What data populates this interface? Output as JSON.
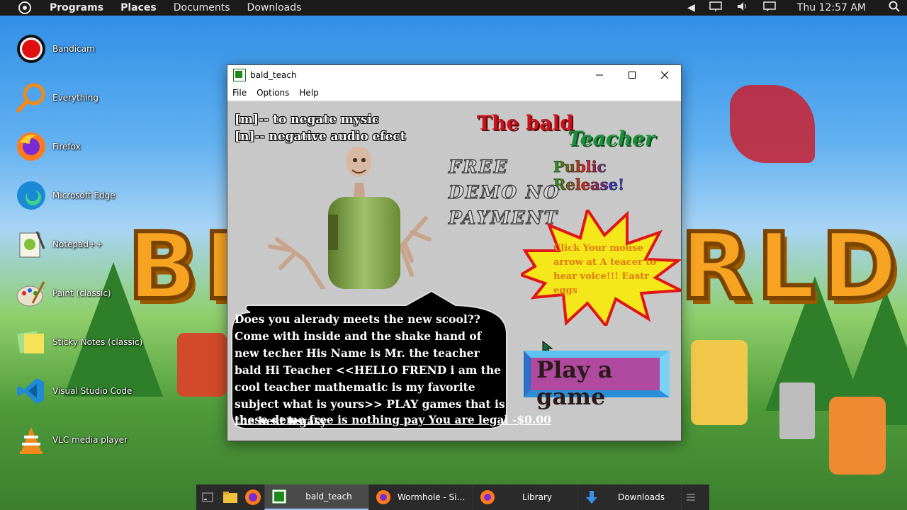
{
  "top_panel": {
    "menus": [
      "Programs",
      "Places",
      "Documents",
      "Downloads"
    ],
    "clock": "Thu 12:57 AM"
  },
  "desktop_icons": [
    {
      "label": "Bandicam",
      "icon": "bandicam-icon"
    },
    {
      "label": "Everything",
      "icon": "everything-search-icon"
    },
    {
      "label": "Firefox",
      "icon": "firefox-icon"
    },
    {
      "label": "Microsoft Edge",
      "icon": "edge-icon"
    },
    {
      "label": "Notepad++",
      "icon": "notepadpp-icon"
    },
    {
      "label": "Paint (classic)",
      "icon": "paint-icon"
    },
    {
      "label": "Sticky Notes (classic)",
      "icon": "sticky-notes-icon"
    },
    {
      "label": "Visual Studio Code",
      "icon": "vscode-icon"
    },
    {
      "label": "VLC media player",
      "icon": "vlc-icon"
    }
  ],
  "window": {
    "title": "bald_teach",
    "menu": [
      "File",
      "Options",
      "Help"
    ],
    "hint_lines": [
      "[m]-- to negate mysic",
      "[n]-- negative audio efect"
    ],
    "title_bald": "The bald",
    "title_teacher": "Teacher",
    "public_release": "Public Release!",
    "free_lines": [
      "FREE",
      "DEMO NO",
      "PAYMENT"
    ],
    "star_text": "Click Your mouse arrow at A teacer to hear voice!!! Eastr eggs",
    "bubble_text": "Does you alerady meets the new scool??Come with inside and the shake hand of new techer His Name is Mr. the teacher bald Hi Teacher <<HELLO FREND i am the cool teacher mathematic is my favorite subject what is yours>> PLAY games that is the best legasy",
    "bubble_footer": "these demo free is nothing pay You are legal -$0.00",
    "play_label": "Play a game"
  },
  "taskbar": {
    "tasks": [
      "bald_teach",
      "Wormhole - Simpl...",
      "Library",
      "Downloads"
    ]
  },
  "colors": {
    "panel_bg": "#1b1b1b",
    "window_client": "#c8c8c8",
    "title_red": "#c8111a",
    "title_green": "#1c8f3b",
    "star_yellow": "#f5e81a",
    "star_border": "#e01515",
    "play_bg": "#b04aa0",
    "play_border": "#2a8fd8"
  }
}
